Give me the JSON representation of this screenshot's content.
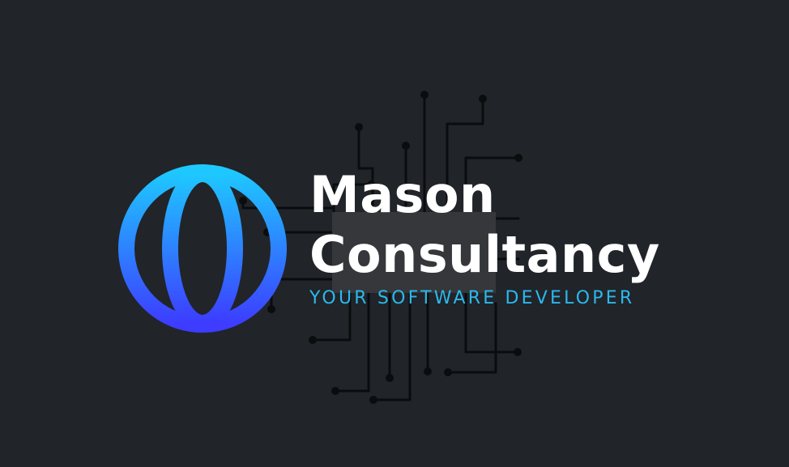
{
  "brand": {
    "name_line_1": "Mason",
    "name_line_2": "Consultancy",
    "tagline": "YOUR SOFTWARE DEVELOPER"
  },
  "icons": {
    "logo": "globe-icon",
    "background": "circuit-chip-icon"
  },
  "colors": {
    "background": "#212429",
    "chip": "#35373a",
    "circuit": "#0b0c0e",
    "name": "#ffffff",
    "tagline": "#2bb8ec",
    "globe_gradient_top": "#1ec8ff",
    "globe_gradient_bottom": "#3d3cff"
  }
}
